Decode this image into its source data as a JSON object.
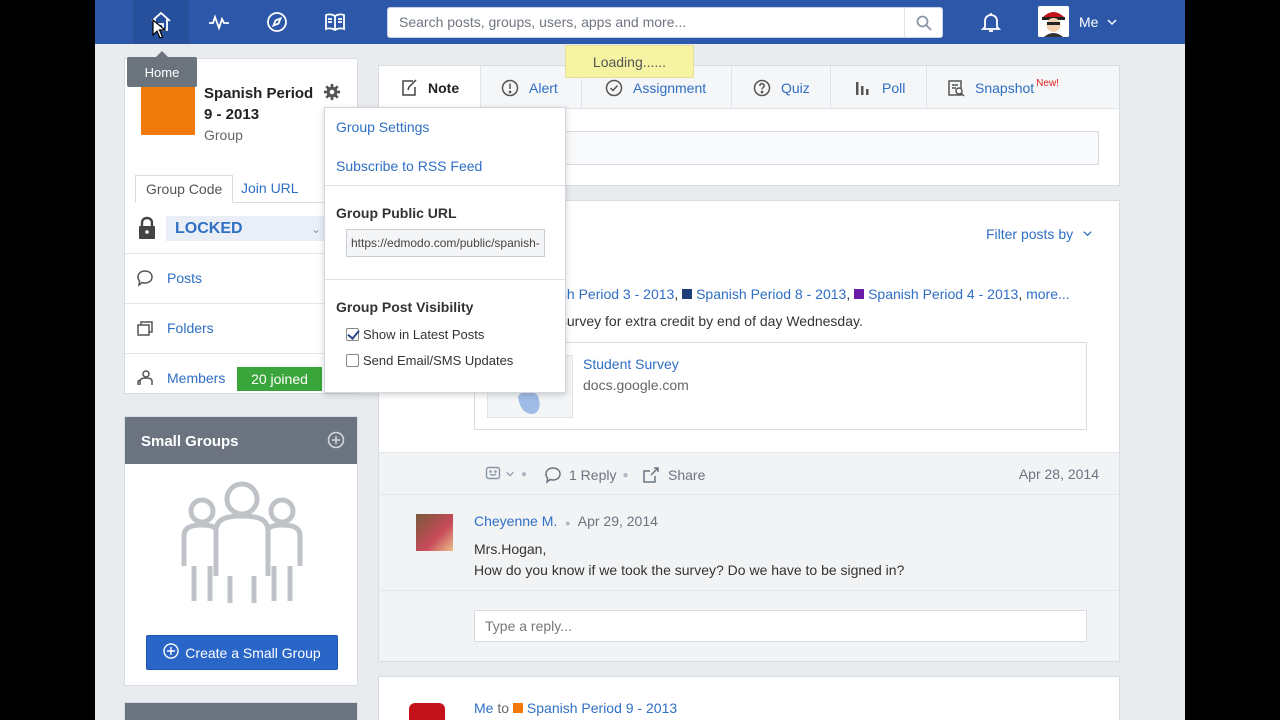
{
  "topnav": {
    "icons": [
      "home-icon",
      "activity-icon",
      "compass-icon",
      "book-icon"
    ],
    "search_placeholder": "Search posts, groups, users, apps and more...",
    "user_label": "Me"
  },
  "tooltip": "Home",
  "loading": "Loading......",
  "group": {
    "title": "Spanish Period 9 - 2013",
    "type": "Group",
    "tab_code": "Group Code",
    "tab_url": "Join URL",
    "locked": "LOCKED",
    "nav": {
      "posts": "Posts",
      "folders": "Folders",
      "members": "Members",
      "joined": "20 joined"
    },
    "accent": "#f07b0c"
  },
  "small_groups": {
    "title": "Small Groups",
    "create_button": "Create a Small Group"
  },
  "dropdown": {
    "settings": "Group Settings",
    "rss": "Subscribe to RSS Feed",
    "public_url_heading": "Group Public URL",
    "public_url_value": "https://edmodo.com/public/spanish-",
    "visibility_heading": "Group Post Visibility",
    "show_latest": "Show in Latest Posts",
    "show_latest_checked": true,
    "send_updates": "Send Email/SMS Updates",
    "send_updates_checked": false
  },
  "composer": {
    "tabs": [
      {
        "label": "Note",
        "icon": "note-icon"
      },
      {
        "label": "Alert",
        "icon": "alert-icon"
      },
      {
        "label": "Assignment",
        "icon": "assignment-icon"
      },
      {
        "label": "Quiz",
        "icon": "quiz-icon"
      },
      {
        "label": "Poll",
        "icon": "poll-icon"
      },
      {
        "label": "Snapshot",
        "icon": "snapshot-icon",
        "badge": "New!"
      }
    ]
  },
  "feed": {
    "filter": "Filter posts by",
    "recipients": [
      {
        "label": "nish Period 3 - 2013",
        "color": null
      },
      {
        "label": "Spanish Period 8 - 2013",
        "color": "#1f3f7a"
      },
      {
        "label": "Spanish Period 4 - 2013",
        "color": "#6a1aa8"
      }
    ],
    "more": "more...",
    "post_text": "s survey for extra credit by end of day Wednesday.",
    "link_title": "Student Survey",
    "link_url": "docs.google.com",
    "reply_count": "1 Reply",
    "share": "Share",
    "post_date": "Apr 28, 2014",
    "comment": {
      "author": "Cheyenne M.",
      "date": "Apr 29, 2014",
      "line1": "Mrs.Hogan,",
      "line2": "How do you know if we took the survey? Do we have to be signed in?"
    },
    "reply_placeholder": "Type a reply...",
    "next_post": {
      "from": "Me",
      "to_word": "to",
      "group": "Spanish Period 9 - 2013",
      "group_color": "#f07b0c"
    }
  },
  "colors": {
    "nav_bg": "#2d57a8",
    "link": "#2f6fc4",
    "joined_green": "#3aa53a"
  }
}
